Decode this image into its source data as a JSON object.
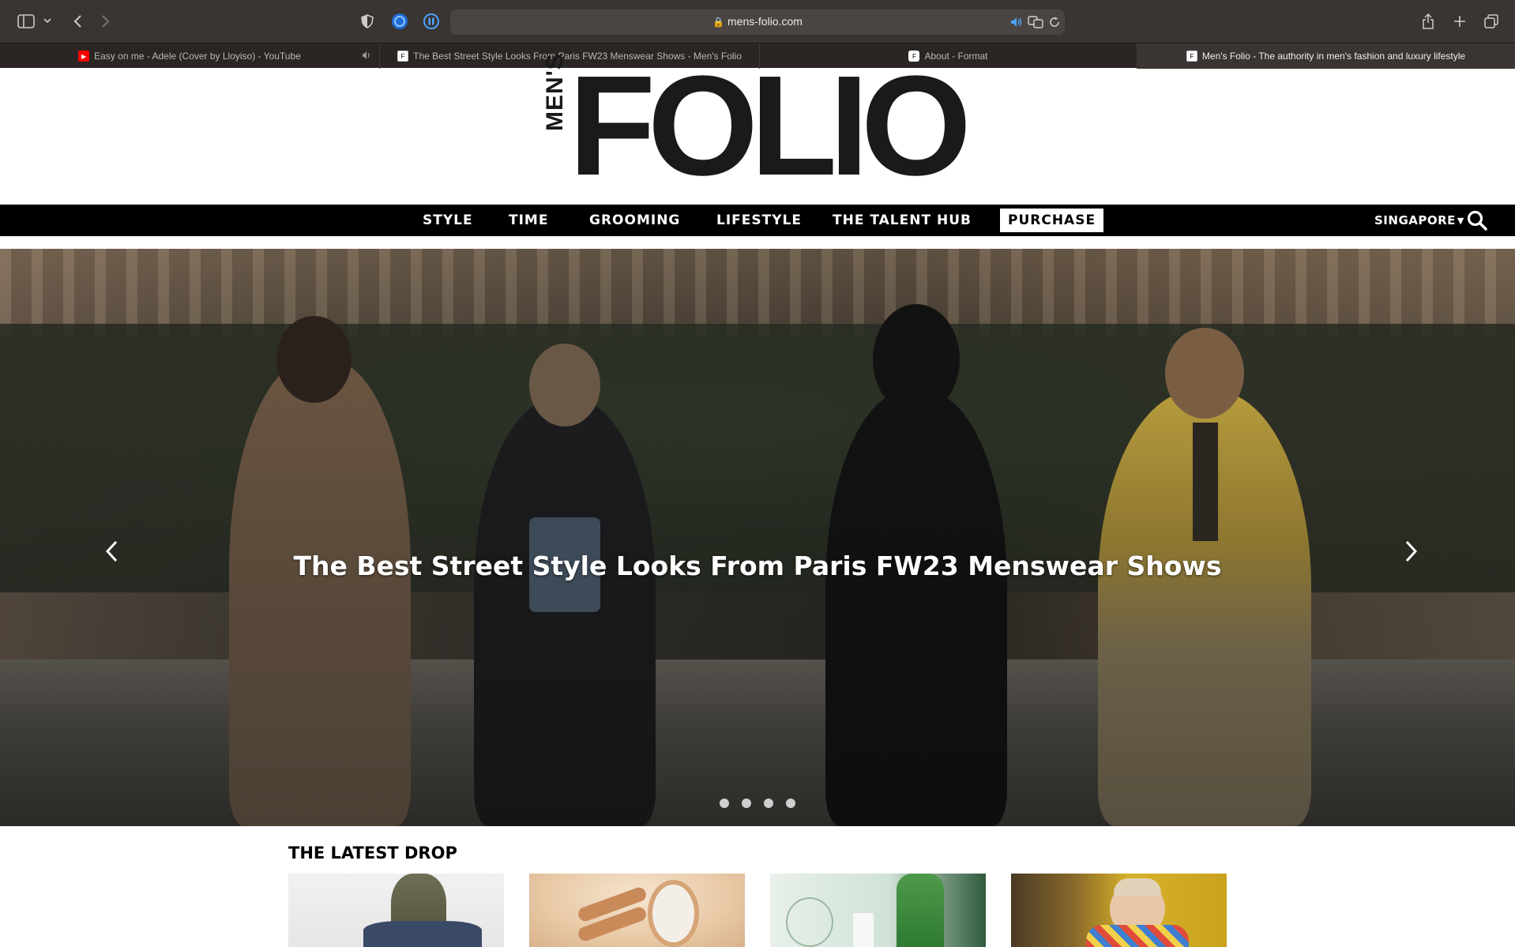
{
  "browser": {
    "url": "mens-folio.com",
    "icons": {
      "sidebar": "sidebar-icon",
      "back": "chevron-left-icon",
      "forward": "chevron-right-icon",
      "shield": "shield-icon",
      "share": "share-icon",
      "new_tab": "plus-icon",
      "tabs_overview": "tabs-overview-icon"
    },
    "tabs": [
      {
        "label": "Easy on me - Adele (Cover by Lloyiso) - YouTube",
        "active": false,
        "favicon": "youtube-icon"
      },
      {
        "label": "The Best Street Style Looks From Paris FW23 Menswear Shows - Men's Folio",
        "active": false,
        "favicon": "folio-icon"
      },
      {
        "label": "About - Format",
        "active": false,
        "favicon": "format-icon"
      },
      {
        "label": "Men's Folio - The authority in men's fashion and luxury lifestyle",
        "active": true,
        "favicon": "folio-icon"
      }
    ]
  },
  "site": {
    "logo_small": "MEN'S",
    "logo_main": "FOLIO",
    "nav": [
      {
        "label": "STYLE"
      },
      {
        "label": "TIME"
      },
      {
        "label": "GROOMING"
      },
      {
        "label": "LIFESTYLE"
      },
      {
        "label": "THE TALENT HUB"
      },
      {
        "label": "PURCHASE"
      }
    ],
    "region": "SINGAPORE",
    "colors": {
      "nav_bg": "#000000",
      "nav_text": "#ffffff"
    }
  },
  "hero": {
    "title": "The Best Street Style Looks From Paris FW23 Menswear Shows",
    "slides_count": 4,
    "active_slide": 1
  },
  "latest": {
    "heading": "THE LATEST DROP"
  }
}
